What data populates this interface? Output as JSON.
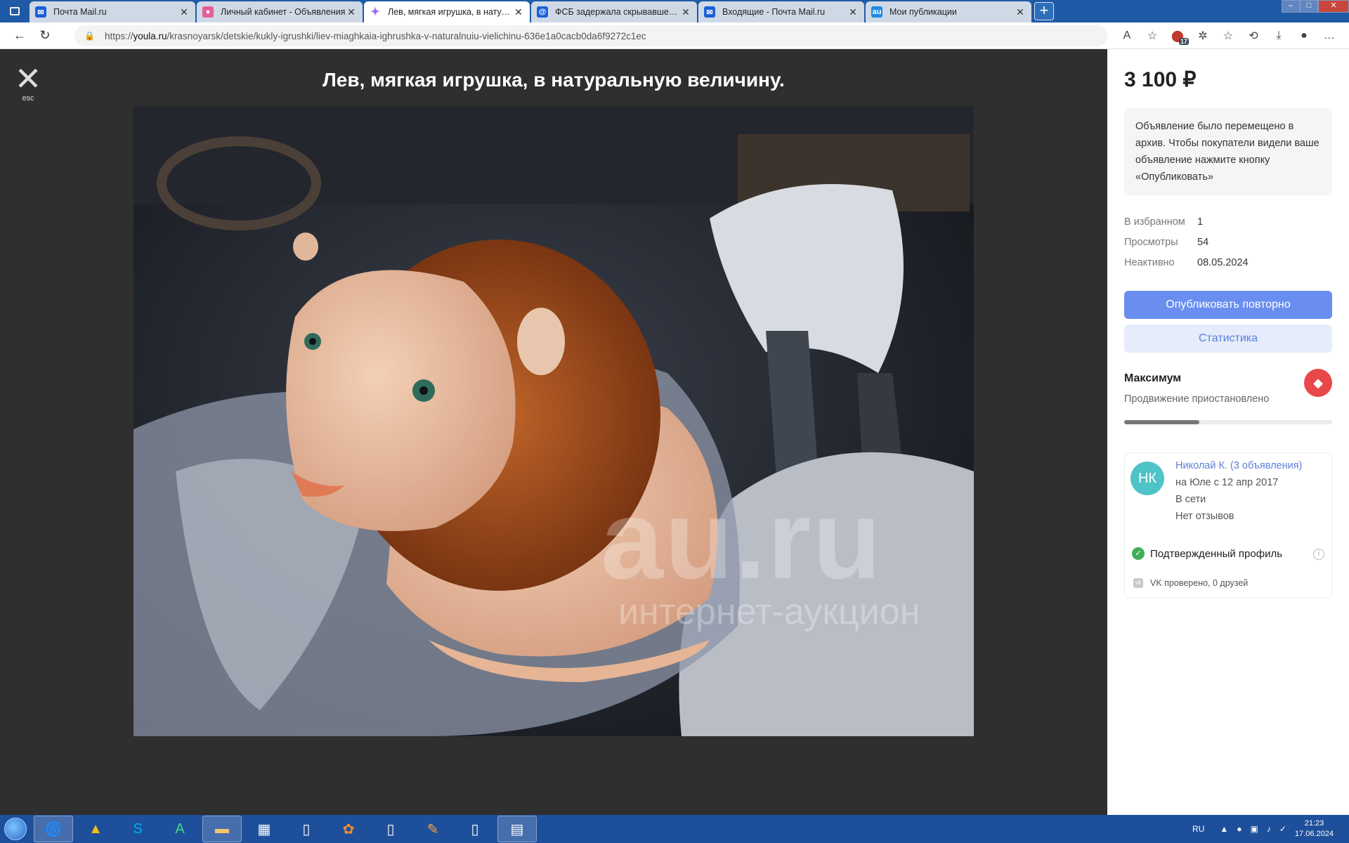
{
  "browser": {
    "tabs": [
      {
        "title": "Почта Mail.ru",
        "favicon": "mail-icon",
        "color": "#1a5fd8",
        "active": false
      },
      {
        "title": "Личный кабинет - Объявления",
        "favicon": "dots-icon",
        "color": "#e85c9b",
        "active": false
      },
      {
        "title": "Лев, мягкая игрушка, в натурал",
        "favicon": "star-icon",
        "color": "#9b6bff",
        "active": true
      },
      {
        "title": "ФСБ задержала скрывавшегося",
        "favicon": "at-icon",
        "color": "#1a5fd8",
        "active": false
      },
      {
        "title": "Входящие - Почта Mail.ru",
        "favicon": "mail-icon",
        "color": "#1a5fd8",
        "active": false
      },
      {
        "title": "Мои публикации",
        "favicon": "au-icon",
        "color": "#1e88e5",
        "active": false
      }
    ],
    "url_prefix": "https://",
    "url_host": "youla.ru",
    "url_path": "/krasnoyarsk/detskie/kukly-igrushki/liev-miaghkaia-ighrushka-v-naturalnuiu-vielichinu-636e1a0cacb0da6f9272c1ec",
    "extension_badge": "17"
  },
  "viewer": {
    "close_label": "esc",
    "title": "Лев, мягкая игрушка, в натуральную величину.",
    "watermark_top": "au.ru",
    "watermark_bottom": "интернет-аукцион"
  },
  "sidebar": {
    "price": "3 100 ₽",
    "notice": "Объявление было перемещено в архив. Чтобы покупатели видели ваше объявление нажмите кнопку «Опубликовать»",
    "stats": [
      {
        "key": "В избранном",
        "value": "1"
      },
      {
        "key": "Просмотры",
        "value": "54"
      },
      {
        "key": "Неактивно",
        "value": "08.05.2024"
      }
    ],
    "republish_button": "Опубликовать повторно",
    "stats_button": "Статистика",
    "promo_title": "Максимум",
    "promo_status": "Продвижение приостановлено",
    "promo_progress": 0.36,
    "seller": {
      "initials": "НК",
      "name": "Николай К. (3 объявления)",
      "since": "на Юле с 12 апр 2017",
      "online": "В сети",
      "reviews": "Нет отзывов",
      "verified": "Подтвержденный профиль",
      "vk": "VK проверено, 0 друзей"
    }
  },
  "taskbar": {
    "lang": "RU",
    "time": "21:23",
    "date": "17.06.2024"
  }
}
